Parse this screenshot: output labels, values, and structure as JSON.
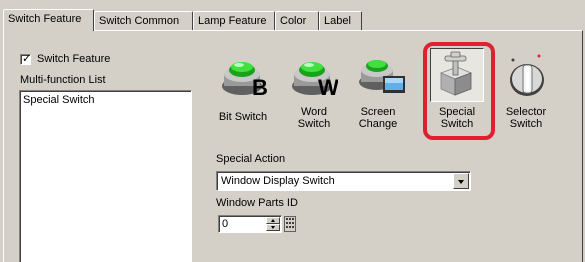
{
  "tabs": [
    {
      "label": "Switch Feature",
      "active": true
    },
    {
      "label": "Switch Common",
      "active": false
    },
    {
      "label": "Lamp Feature",
      "active": false
    },
    {
      "label": "Color",
      "active": false
    },
    {
      "label": "Label",
      "active": false
    }
  ],
  "switch_feature": {
    "label": "Switch Feature",
    "checked": true
  },
  "multi_function": {
    "label": "Multi-function List",
    "items": [
      "Special Switch"
    ]
  },
  "switch_types": [
    {
      "line1": "Bit Switch",
      "line2": "",
      "icon": "bit-switch-icon",
      "selected": false
    },
    {
      "line1": "Word",
      "line2": "Switch",
      "icon": "word-switch-icon",
      "selected": false
    },
    {
      "line1": "Screen",
      "line2": "Change",
      "icon": "screen-change-icon",
      "selected": false
    },
    {
      "line1": "Special",
      "line2": "Switch",
      "icon": "special-switch-icon",
      "selected": true
    },
    {
      "line1": "Selector",
      "line2": "Switch",
      "icon": "selector-switch-icon",
      "selected": false
    }
  ],
  "special_action": {
    "label": "Special Action",
    "value": "Window Display Switch"
  },
  "window_parts": {
    "label": "Window Parts ID",
    "value": "0"
  },
  "colors": {
    "highlight": "#e02030",
    "panel": "#d4d0c8",
    "button_green": "#2ecc2e"
  }
}
